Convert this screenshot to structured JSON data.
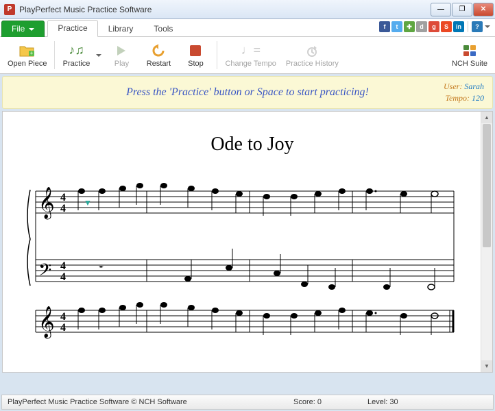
{
  "window": {
    "title": "PlayPerfect Music Practice Software",
    "app_icon_letter": "P"
  },
  "menu": {
    "file": "File",
    "tabs": [
      "Practice",
      "Library",
      "Tools"
    ],
    "active_tab": "Practice"
  },
  "social": [
    {
      "name": "facebook-icon",
      "glyph": "f",
      "bg": "#3b5998"
    },
    {
      "name": "twitter-icon",
      "glyph": "t",
      "bg": "#55acee"
    },
    {
      "name": "share-icon",
      "glyph": "✚",
      "bg": "#5fa641"
    },
    {
      "name": "digg-icon",
      "glyph": "d",
      "bg": "#a0a0a0"
    },
    {
      "name": "google-icon",
      "glyph": "g",
      "bg": "#dd4b39"
    },
    {
      "name": "stumble-icon",
      "glyph": "S",
      "bg": "#eb4924"
    },
    {
      "name": "linkedin-icon",
      "glyph": "in",
      "bg": "#0077b5"
    }
  ],
  "help_glyph": "?",
  "toolbar": {
    "open": "Open Piece",
    "practice": "Practice",
    "play": "Play",
    "restart": "Restart",
    "stop": "Stop",
    "change_tempo": "Change Tempo",
    "history": "Practice History",
    "suite": "NCH Suite"
  },
  "banner": {
    "message": "Press the 'Practice' button or Space to start practicing!",
    "user_label": "User:",
    "user_value": "Sarah",
    "tempo_label": "Tempo:",
    "tempo_value": "120"
  },
  "piece": {
    "title": "Ode to Joy",
    "time_signature": "4/4"
  },
  "status": {
    "product": "PlayPerfect Music Practice Software © NCH Software",
    "score_label": "Score:",
    "score_value": "0",
    "level_label": "Level:",
    "level_value": "30"
  },
  "chart_data": {
    "type": "music-staff",
    "title": "Ode to Joy",
    "clefs": [
      "treble",
      "bass"
    ],
    "time_signature": "4/4",
    "systems": [
      {
        "treble": [
          [
            "E5",
            "E5",
            "F5",
            "G5"
          ],
          [
            "G5",
            "F5",
            "E5",
            "D5"
          ],
          [
            "C5",
            "C5",
            "D5",
            "E5"
          ],
          [
            "E5.",
            "D5",
            "D5"
          ]
        ],
        "bass": [
          [
            "rest"
          ],
          [
            "C3",
            "G3"
          ],
          [
            "E3",
            "C3",
            "G2"
          ],
          [
            "G2",
            "G2"
          ]
        ]
      },
      {
        "treble": [
          [
            "E5",
            "E5",
            "F5",
            "G5"
          ],
          [
            "G5",
            "F5",
            "E5",
            "D5"
          ],
          [
            "C5",
            "C5",
            "D5",
            "E5"
          ],
          [
            "D5.",
            "C5",
            "C5"
          ]
        ]
      }
    ]
  }
}
